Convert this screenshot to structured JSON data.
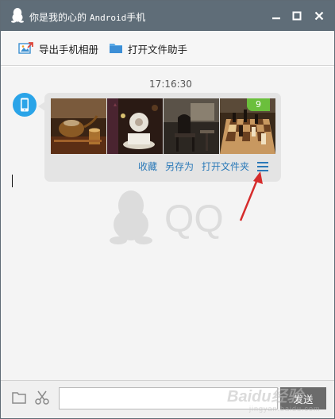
{
  "window": {
    "title_prefix": "你是我的心的 ",
    "title_device": "Android",
    "title_suffix": "手机"
  },
  "toolbar": {
    "export_album_label": "导出手机相册",
    "open_file_assistant_label": "打开文件助手"
  },
  "chat": {
    "timestamp": "17:16:30",
    "message": {
      "images": [
        "teapot-photo",
        "flower-teacup-photo",
        "cafe-chair-photo",
        "chessboard-photo"
      ],
      "image_count": "9",
      "actions": {
        "favorite_label": "收藏",
        "save_as_label": "另存为",
        "open_folder_label": "打开文件夹",
        "menu_icon": "menu-icon"
      }
    },
    "watermark_text": "QQ"
  },
  "input": {
    "placeholder": "",
    "send_label": "发送"
  },
  "overlay": {
    "arrow_color": "#d62c2c",
    "watermark_text": "Baidu经验",
    "watermark_sub": "jingyan.baidu.com"
  },
  "colors": {
    "titlebar": "#5f6d78",
    "link": "#2a79b8",
    "badge": "#6bbf3c",
    "send_button": "#6b6b6b"
  }
}
